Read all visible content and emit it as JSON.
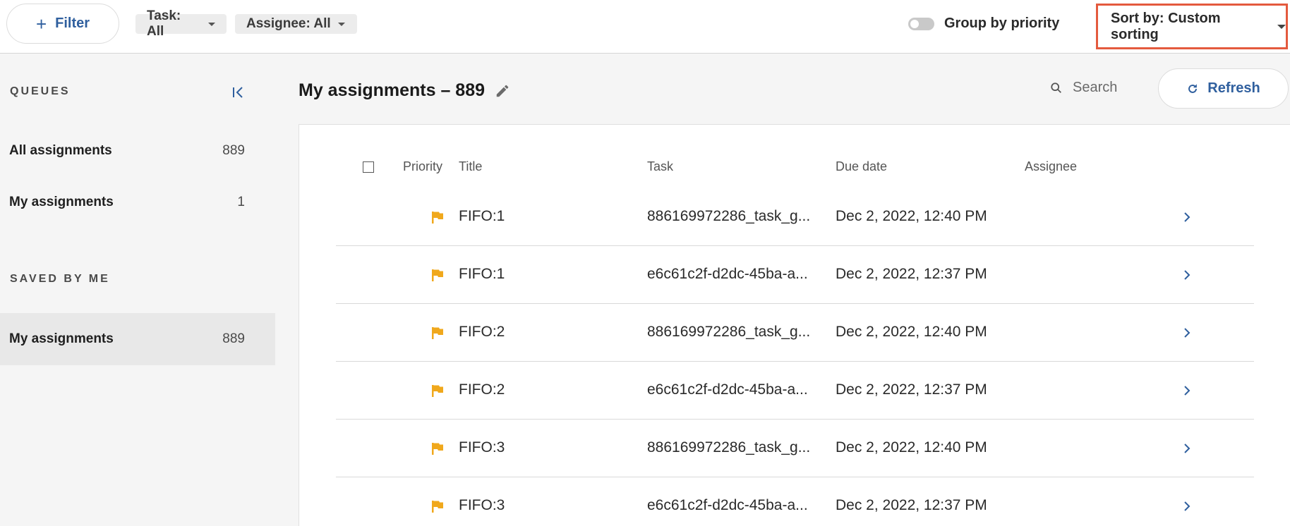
{
  "toolbar": {
    "filter_label": "Filter",
    "task_chip": "Task: All",
    "assignee_chip": "Assignee: All",
    "group_by_priority": "Group by priority",
    "group_by_priority_on": false,
    "sort_label": "Sort by: Custom sorting"
  },
  "sidebar": {
    "queues_title": "QUEUES",
    "queues": [
      {
        "label": "All assignments",
        "count": "889"
      },
      {
        "label": "My assignments",
        "count": "1"
      }
    ],
    "saved_title": "SAVED BY ME",
    "saved": [
      {
        "label": "My assignments",
        "count": "889"
      }
    ]
  },
  "main": {
    "title": "My assignments – 889",
    "search_placeholder": "Search",
    "refresh_label": "Refresh"
  },
  "table": {
    "headers": {
      "priority": "Priority",
      "title": "Title",
      "task": "Task",
      "due": "Due date",
      "assignee": "Assignee"
    },
    "rows": [
      {
        "title": "FIFO:1",
        "task": "886169972286_task_g...",
        "due": "Dec 2, 2022, 12:40 PM",
        "assignee": ""
      },
      {
        "title": "FIFO:1",
        "task": "e6c61c2f-d2dc-45ba-a...",
        "due": "Dec 2, 2022, 12:37 PM",
        "assignee": ""
      },
      {
        "title": "FIFO:2",
        "task": "886169972286_task_g...",
        "due": "Dec 2, 2022, 12:40 PM",
        "assignee": ""
      },
      {
        "title": "FIFO:2",
        "task": "e6c61c2f-d2dc-45ba-a...",
        "due": "Dec 2, 2022, 12:37 PM",
        "assignee": ""
      },
      {
        "title": "FIFO:3",
        "task": "886169972286_task_g...",
        "due": "Dec 2, 2022, 12:40 PM",
        "assignee": ""
      },
      {
        "title": "FIFO:3",
        "task": "e6c61c2f-d2dc-45ba-a...",
        "due": "Dec 2, 2022, 12:37 PM",
        "assignee": ""
      }
    ]
  },
  "colors": {
    "accent": "#2f5f9e",
    "highlight_border": "#e45a3e",
    "priority_flag": "#f0a81c"
  },
  "icons": {
    "filter": "plus-icon",
    "collapse": "collapse-left-icon",
    "edit": "pencil-icon",
    "search": "search-icon",
    "refresh": "refresh-icon",
    "priority": "flag-icon",
    "row_action": "chevron-right-icon"
  }
}
